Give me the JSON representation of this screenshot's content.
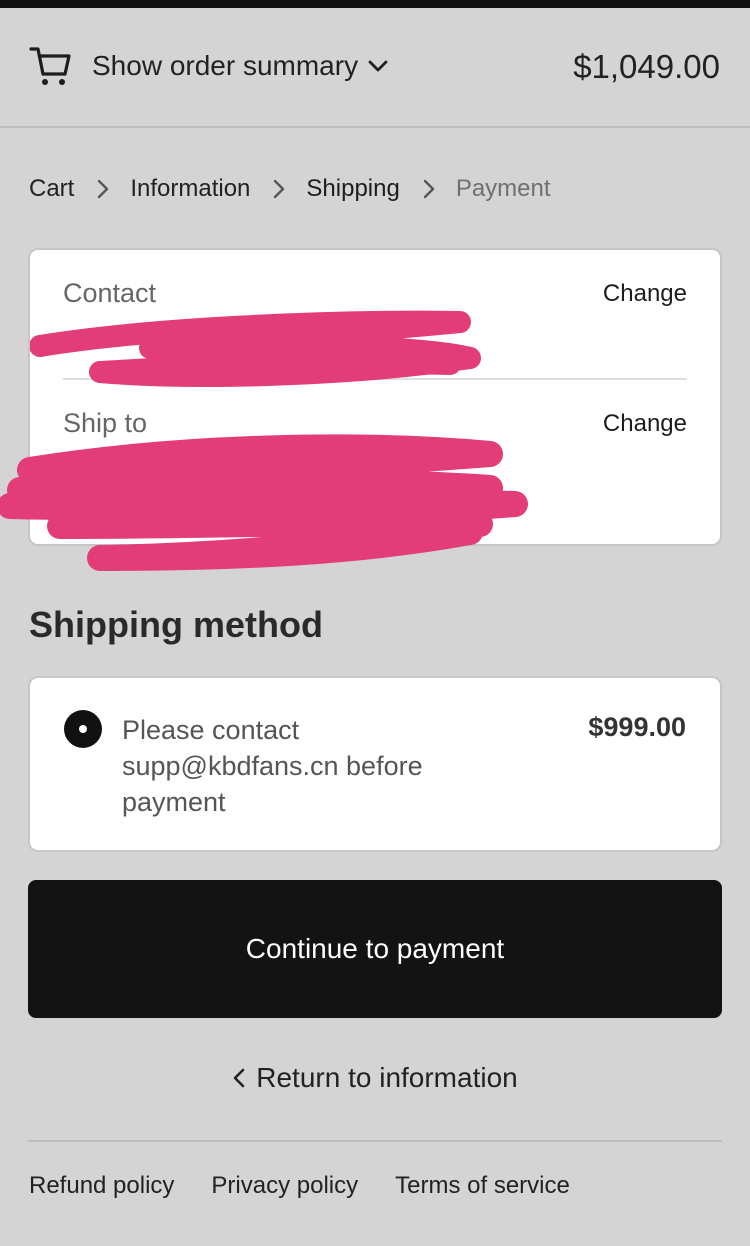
{
  "header": {
    "summary_toggle_label": "Show order summary",
    "total": "$1,049.00",
    "icons": [
      "cart-icon",
      "chevron-down-icon"
    ]
  },
  "breadcrumb": [
    {
      "label": "Cart",
      "state": "link"
    },
    {
      "label": "Information",
      "state": "link"
    },
    {
      "label": "Shipping",
      "state": "current"
    },
    {
      "label": "Payment",
      "state": "disabled"
    }
  ],
  "review": {
    "contact": {
      "label": "Contact",
      "change_label": "Change"
    },
    "ship_to": {
      "label": "Ship to",
      "change_label": "Change"
    }
  },
  "shipping_method": {
    "title": "Shipping method",
    "option": {
      "text": "Please contact supp@kbdfans.cn before payment",
      "price": "$999.00",
      "selected": true
    }
  },
  "actions": {
    "continue_label": "Continue to payment",
    "return_label": "Return to information"
  },
  "footer": {
    "links": [
      "Refund policy",
      "Privacy policy",
      "Terms of service"
    ]
  },
  "colors": {
    "background": "#d4d4d4",
    "button": "#131313",
    "redaction": "#e23d79"
  }
}
